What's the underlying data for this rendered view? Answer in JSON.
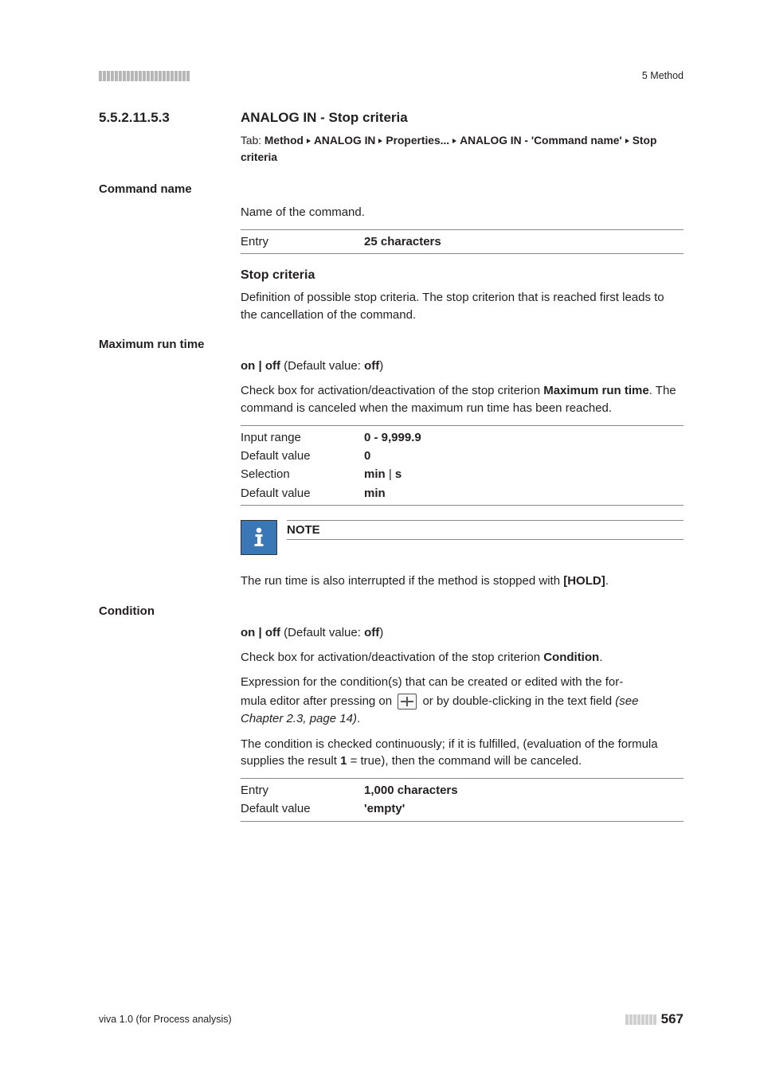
{
  "header": {
    "right": "5 Method"
  },
  "section": {
    "num": "5.5.2.11.5.3",
    "title": "ANALOG IN - Stop criteria",
    "tab_prefix": "Tab: ",
    "path": [
      "Method",
      "ANALOG IN",
      "Properties...",
      "ANALOG IN - 'Command name'",
      "Stop criteria"
    ]
  },
  "command_name": {
    "heading": "Command name",
    "desc": "Name of the command.",
    "entry_label": "Entry",
    "entry_value": "25 characters"
  },
  "stop_criteria": {
    "heading": "Stop criteria",
    "desc": "Definition of possible stop criteria. The stop criterion that is reached first leads to the cancellation of the command."
  },
  "max_run": {
    "heading": "Maximum run time",
    "onoff_prefix": "on | off",
    "onoff_mid": " (Default value: ",
    "onoff_val": "off",
    "onoff_suffix": ")",
    "desc_pre": "Check box for activation/deactivation of the stop criterion ",
    "desc_bold": "Maximum run time",
    "desc_post": ". The command is canceled when the maximum run time has been reached.",
    "rows": {
      "r1_label": "Input range",
      "r1_value": "0 - 9,999.9",
      "r2_label": "Default value",
      "r2_value": "0",
      "r3_label": "Selection",
      "r3_value_a": "min",
      "r3_value_sep": " | ",
      "r3_value_b": "s",
      "r4_label": "Default value",
      "r4_value": "min"
    }
  },
  "note": {
    "title": "NOTE",
    "body_pre": "The run time is also interrupted if the method is stopped with ",
    "body_bold": "[HOLD]",
    "body_post": "."
  },
  "condition": {
    "heading": "Condition",
    "onoff_prefix": "on | off",
    "onoff_mid": " (Default value: ",
    "onoff_val": "off",
    "onoff_suffix": ")",
    "desc1_pre": "Check box for activation/deactivation of the stop criterion ",
    "desc1_bold": "Condition",
    "desc1_post": ".",
    "desc2": "Expression for the condition(s) that can be created or edited with the for-",
    "desc3_pre": "mula editor after pressing on ",
    "desc3_post": " or by double-clicking in the text field ",
    "desc3_ref": "(see Chapter 2.3, page 14)",
    "desc3_dot": ".",
    "desc4_pre": "The condition is checked continuously; if it is fulfilled, (evaluation of the formula supplies the result ",
    "desc4_bold": "1",
    "desc4_post": " = true), then the command will be canceled.",
    "rows": {
      "r1_label": "Entry",
      "r1_value": "1,000 characters",
      "r2_label": "Default value",
      "r2_value": "'empty'"
    }
  },
  "footer": {
    "left": "viva 1.0 (for Process analysis)",
    "page": "567"
  }
}
